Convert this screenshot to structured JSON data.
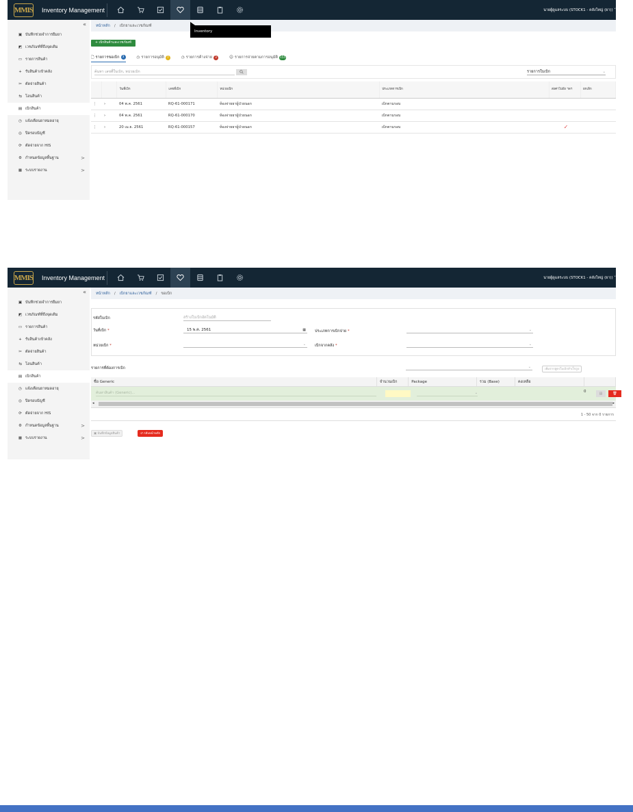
{
  "app": {
    "logo_text": "MMIS",
    "title": "Inventory Management",
    "user": "นายผู้ดูแลระบบ (STOCK1 - คลังใหญ่ (ยา))",
    "nav_icons": [
      "home-icon",
      "cart-icon",
      "checklist-icon",
      "inventory-icon",
      "database-icon",
      "clipboard-icon",
      "settings-icon"
    ],
    "active_nav": "inventory-icon"
  },
  "sidebar": {
    "collapse": "«",
    "items": [
      {
        "label": "บันทึกช่วยจำการยืมยา",
        "icon": "note-icon"
      },
      {
        "label": "เวชภัณฑ์ที่ถึงจุดเติม",
        "icon": "alert-icon"
      },
      {
        "label": "รายการสินค้า",
        "icon": "folder-icon"
      },
      {
        "label": "รับสินค้าเข้าคลัง",
        "icon": "plus-icon"
      },
      {
        "label": "ตัดจ่ายสินค้า",
        "icon": "scissors-icon"
      },
      {
        "label": "โอนสินค้า",
        "icon": "transfer-icon"
      },
      {
        "label": "เบิกสินค้า",
        "icon": "package-icon"
      },
      {
        "label": "แจ้งเตือนยาหมดอายุ",
        "icon": "clock-icon"
      },
      {
        "label": "ปิดรอบบัญชี",
        "icon": "check-circle-icon"
      },
      {
        "label": "ตัดจ่ายจาก HIS",
        "icon": "sync-icon"
      },
      {
        "label": "กำหนดข้อมูลพื้นฐาน",
        "icon": "gear-icon",
        "chevron": ">"
      },
      {
        "label": "ระบบรายงาน",
        "icon": "printer-icon",
        "chevron": ">"
      }
    ],
    "active_index": 6
  },
  "screen1": {
    "breadcrumb": [
      "หน้าหลัก",
      "เบิกยาและเวชภัณฑ์"
    ],
    "tooltip": "Inventory",
    "new_button": "+ เบิกสินค้าและเวชภัณฑ์",
    "tabs": [
      {
        "label": "รายการขอเบิก",
        "badge": "3",
        "badge_color": "#2b6cb0",
        "icon": "file-icon"
      },
      {
        "label": "รายการอนุมัติ",
        "badge": "7",
        "badge_color": "#e3b51c",
        "icon": "clock-icon"
      },
      {
        "label": "รายการค้างจ่าย",
        "badge": "3",
        "badge_color": "#c0392b",
        "icon": "clock-icon"
      },
      {
        "label": "รายการจ่ายตามการอนุมัติ",
        "badge": "155",
        "badge_color": "#2e8b3e",
        "icon": "check-icon"
      }
    ],
    "search_placeholder": "ค้นหา เลขที่ใบเบิก, หน่วยเบิก",
    "filter_value": "รายการใบเบิก",
    "columns": [
      "",
      "",
      "วันที่เบิก",
      "เลขที่เบิก",
      "หน่วยเบิก",
      "ประเภทการเบิก",
      "ส่งค่าไปยัง ฯลฯ",
      "ยกเลิก"
    ],
    "rows": [
      {
        "date": "04 พ.ค. 2561",
        "number": "RQ-61-000171",
        "unit": "ห้องจ่ายยาผู้ป่วยนอก",
        "type": "เบิกตามรอบ",
        "sent": ""
      },
      {
        "date": "04 พ.ค. 2561",
        "number": "RQ-61-000170",
        "unit": "ห้องจ่ายยาผู้ป่วยนอก",
        "type": "เบิกตามรอบ",
        "sent": ""
      },
      {
        "date": "20 เม.ย. 2561",
        "number": "RQ-61-000157",
        "unit": "ห้องจ่ายยาผู้ป่วยนอก",
        "type": "เบิกตามรอบ",
        "sent": "✓"
      }
    ]
  },
  "screen2": {
    "breadcrumb": [
      "หน้าหลัก",
      "เบิกยาและเวชภัณฑ์",
      "ขอเบิก"
    ],
    "form": {
      "code_label": "รหัสใบเบิก",
      "code_placeholder": "สร้างใบเบิกอัตโนมัติ",
      "date_label": "วันที่เบิก",
      "date_value": "15 พ.ค. 2561",
      "type_label": "ประเภทการเบิกจ่าย",
      "unit_label": "หน่วยเบิก",
      "from_label": "เบิกจากคลัง"
    },
    "section_label": "รายการที่ต้องการเบิก",
    "template_button": "เพิ่มจากสูตรใบเบิกสำเร็จรูป",
    "columns": [
      "ชื่อ Generic",
      "จำนวนเบิก",
      "Package",
      "รวม (Base)",
      "คงเหลือ"
    ],
    "row": {
      "placeholder": "ค้นหาสินค้า (Generic)...",
      "remain": "0"
    },
    "pager": "1 - 50 จาก 0 รายการ",
    "save_button": "บันทึกข้อมูลสินค้า",
    "back_button": "กลับหน้าหลัก"
  }
}
